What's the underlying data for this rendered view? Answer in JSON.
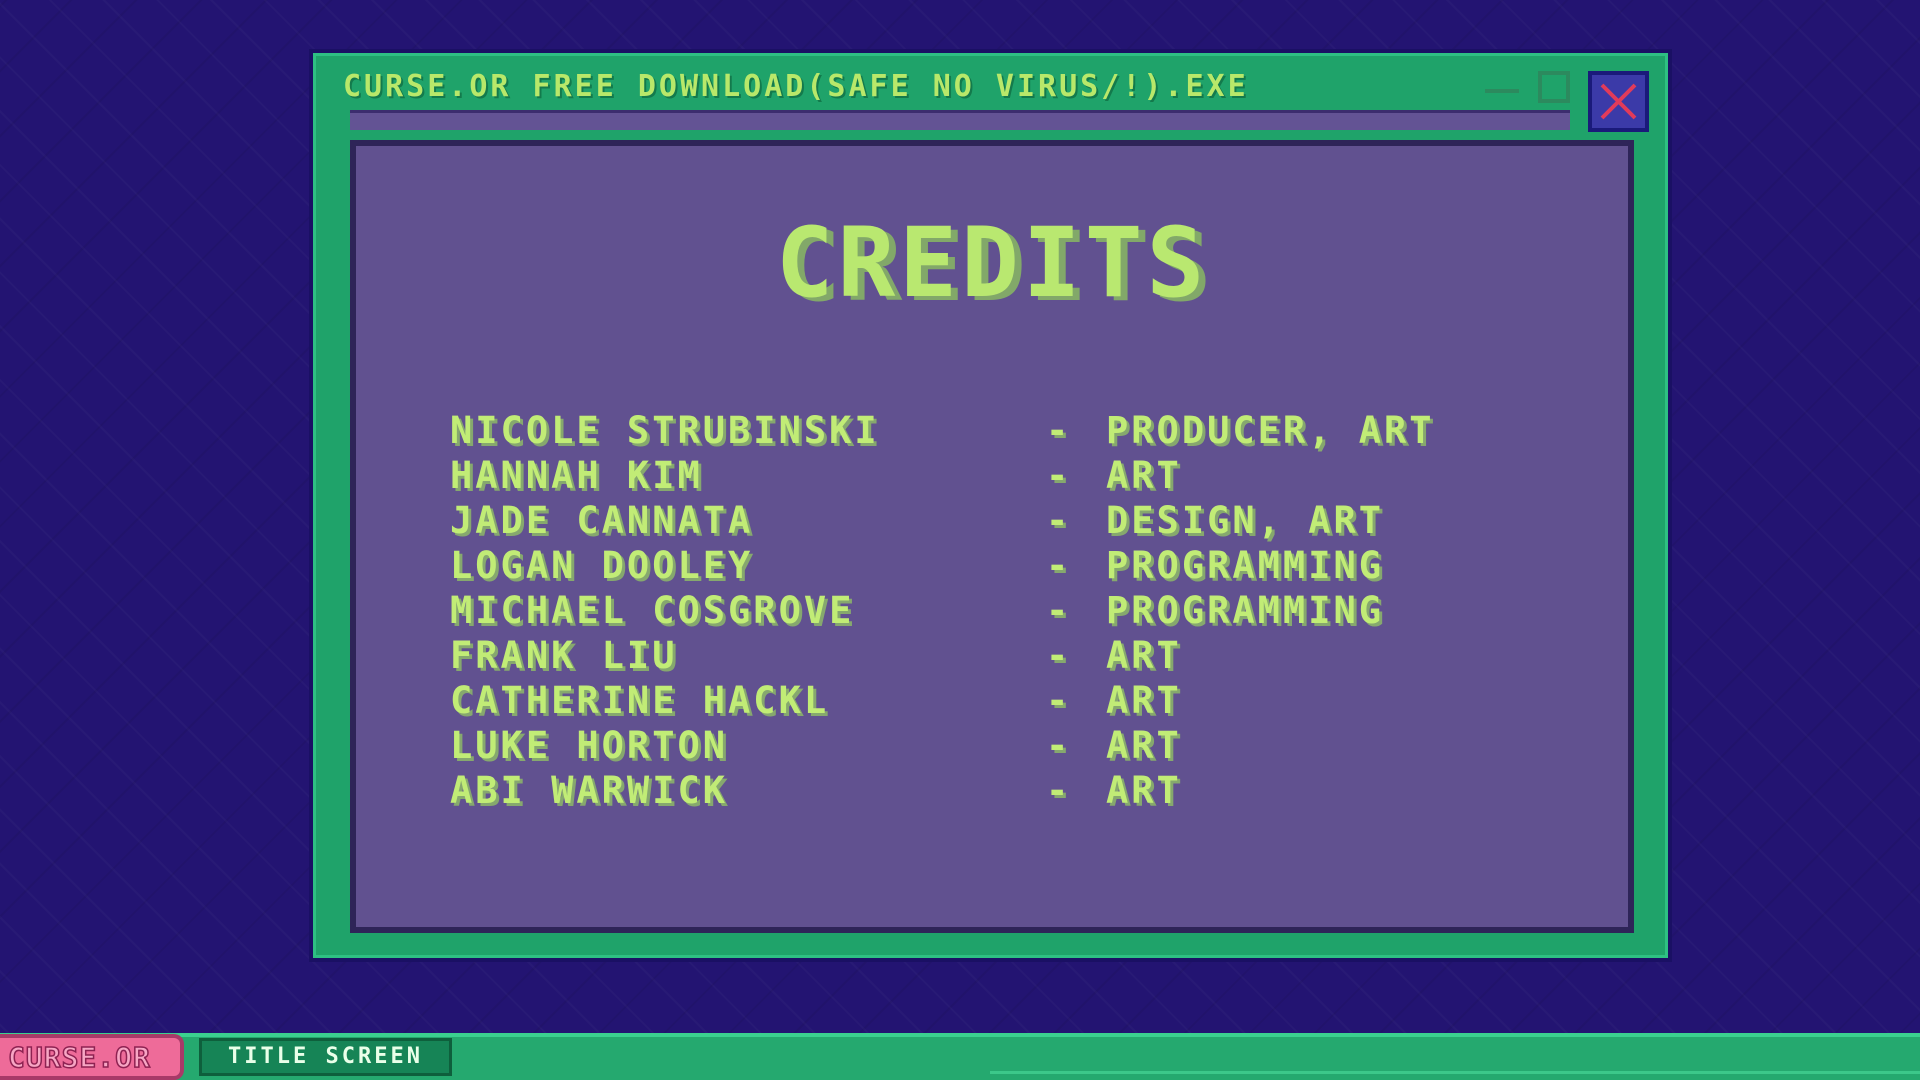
{
  "window": {
    "title": "CURSE.OR FREE DOWNLOAD(SAFE NO VIRUS/!).EXE",
    "buttons": {
      "minimize_icon": "minimize-icon",
      "maximize_icon": "maximize-icon",
      "close_icon": "close-icon"
    }
  },
  "credits": {
    "title": "CREDITS",
    "dash": "-",
    "entries": [
      {
        "name": "NICOLE STRUBINSKI",
        "role": "PRODUCER, ART"
      },
      {
        "name": "HANNAH KIM",
        "role": "ART"
      },
      {
        "name": "JADE CANNATA",
        "role": "DESIGN, ART"
      },
      {
        "name": "LOGAN DOOLEY",
        "role": "PROGRAMMING"
      },
      {
        "name": "MICHAEL COSGROVE",
        "role": "PROGRAMMING"
      },
      {
        "name": "FRANK LIU",
        "role": "ART"
      },
      {
        "name": "CATHERINE HACKL",
        "role": "ART"
      },
      {
        "name": "LUKE HORTON",
        "role": "ART"
      },
      {
        "name": "ABI WARWICK",
        "role": "ART"
      }
    ]
  },
  "taskbar": {
    "start_label": "CURSE.OR",
    "tabs": [
      {
        "label": "TITLE SCREEN"
      }
    ]
  },
  "colors": {
    "background": "#231472",
    "window_frame": "#1fa36a",
    "panel": "#615190",
    "text_green": "#c1ec76",
    "close_red": "#e23b5a",
    "close_blue": "#3b3aa8",
    "start_pink": "#ee6b99",
    "taskbar_green": "#25a96f"
  }
}
